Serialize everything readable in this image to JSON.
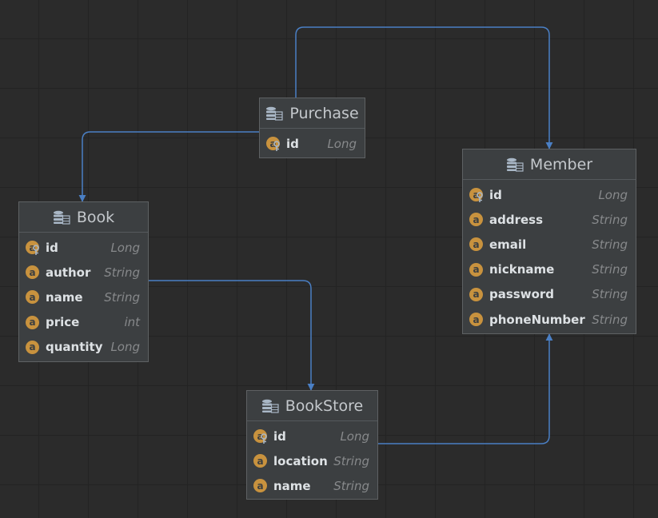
{
  "colors": {
    "canvas": "#2b2b2b",
    "grid": "#232323",
    "entity_bg": "#3c3f41",
    "field_badge": "#c8923e",
    "connector": "#4a7fc4"
  },
  "entities": {
    "purchase": {
      "name": "Purchase",
      "fields": [
        {
          "badge": "a",
          "name": "id",
          "type": "Long",
          "primary_key": true
        }
      ]
    },
    "member": {
      "name": "Member",
      "fields": [
        {
          "badge": "a",
          "name": "id",
          "type": "Long",
          "primary_key": true
        },
        {
          "badge": "a",
          "name": "address",
          "type": "String"
        },
        {
          "badge": "a",
          "name": "email",
          "type": "String"
        },
        {
          "badge": "a",
          "name": "nickname",
          "type": "String"
        },
        {
          "badge": "a",
          "name": "password",
          "type": "String"
        },
        {
          "badge": "a",
          "name": "phoneNumber",
          "type": "String"
        }
      ]
    },
    "book": {
      "name": "Book",
      "fields": [
        {
          "badge": "a",
          "name": "id",
          "type": "Long",
          "primary_key": true
        },
        {
          "badge": "a",
          "name": "author",
          "type": "String"
        },
        {
          "badge": "a",
          "name": "name",
          "type": "String"
        },
        {
          "badge": "a",
          "name": "price",
          "type": "int"
        },
        {
          "badge": "a",
          "name": "quantity",
          "type": "Long"
        }
      ]
    },
    "bookstore": {
      "name": "BookStore",
      "fields": [
        {
          "badge": "a",
          "name": "id",
          "type": "Long",
          "primary_key": true
        },
        {
          "badge": "a",
          "name": "location",
          "type": "String"
        },
        {
          "badge": "a",
          "name": "name",
          "type": "String"
        }
      ]
    }
  },
  "relations": [
    {
      "from": "purchase",
      "to": "member",
      "arrows": "both"
    },
    {
      "from": "purchase",
      "to": "book",
      "arrows": "both"
    },
    {
      "from": "book",
      "to": "bookstore",
      "arrows": "both"
    },
    {
      "from": "bookstore",
      "to": "member",
      "arrows": "to"
    }
  ]
}
